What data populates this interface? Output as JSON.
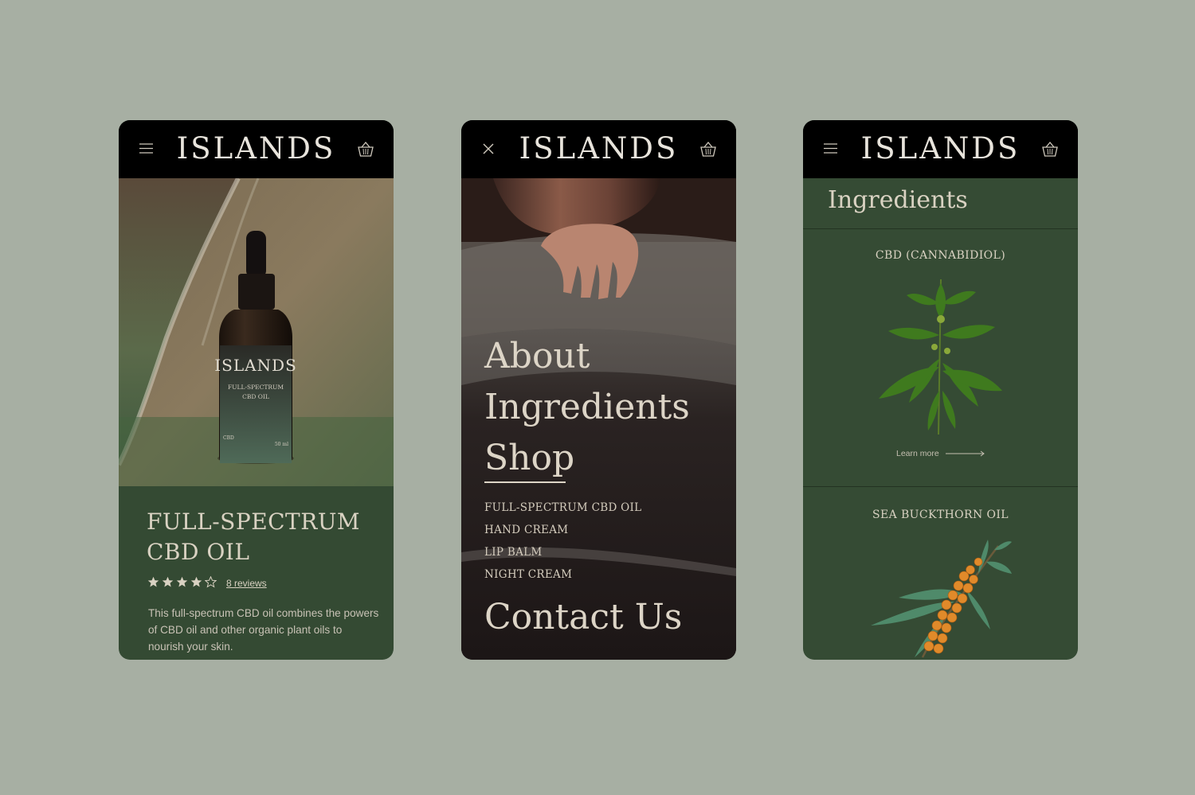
{
  "brand": {
    "logo": "ISLANDS"
  },
  "screen_product": {
    "bottle_label": {
      "brand": "ISLANDS",
      "line1": "FULL-SPECTRUM",
      "line2": "CBD OIL",
      "left_small": "CBD",
      "right_small": "50 ml"
    },
    "title_line1": "FULL-SPECTRUM",
    "title_line2": "CBD OIL",
    "rating": 4,
    "rating_max": 5,
    "reviews_link": "8 reviews",
    "description": "This full-spectrum CBD oil combines the powers of CBD oil and other organic plant oils to nourish your  skin."
  },
  "screen_menu": {
    "nav": {
      "about": "About",
      "ingredients": "Ingredients",
      "shop": "Shop",
      "contact": "Contact Us"
    },
    "shop_items": [
      "FULL-SPECTRUM CBD OIL",
      "HAND CREAM",
      "LIP BALM",
      "NIGHT CREAM"
    ]
  },
  "screen_ingredients": {
    "title": "Ingredients",
    "items": [
      {
        "name": "CBD  (CANNABIDIOL)",
        "link": "Learn more"
      },
      {
        "name": "SEA BUCKTHORN OIL"
      }
    ]
  },
  "colors": {
    "background": "#a7afa3",
    "panel_green": "#344a33",
    "header": "#000000",
    "text_cream": "#d9d2c2"
  }
}
